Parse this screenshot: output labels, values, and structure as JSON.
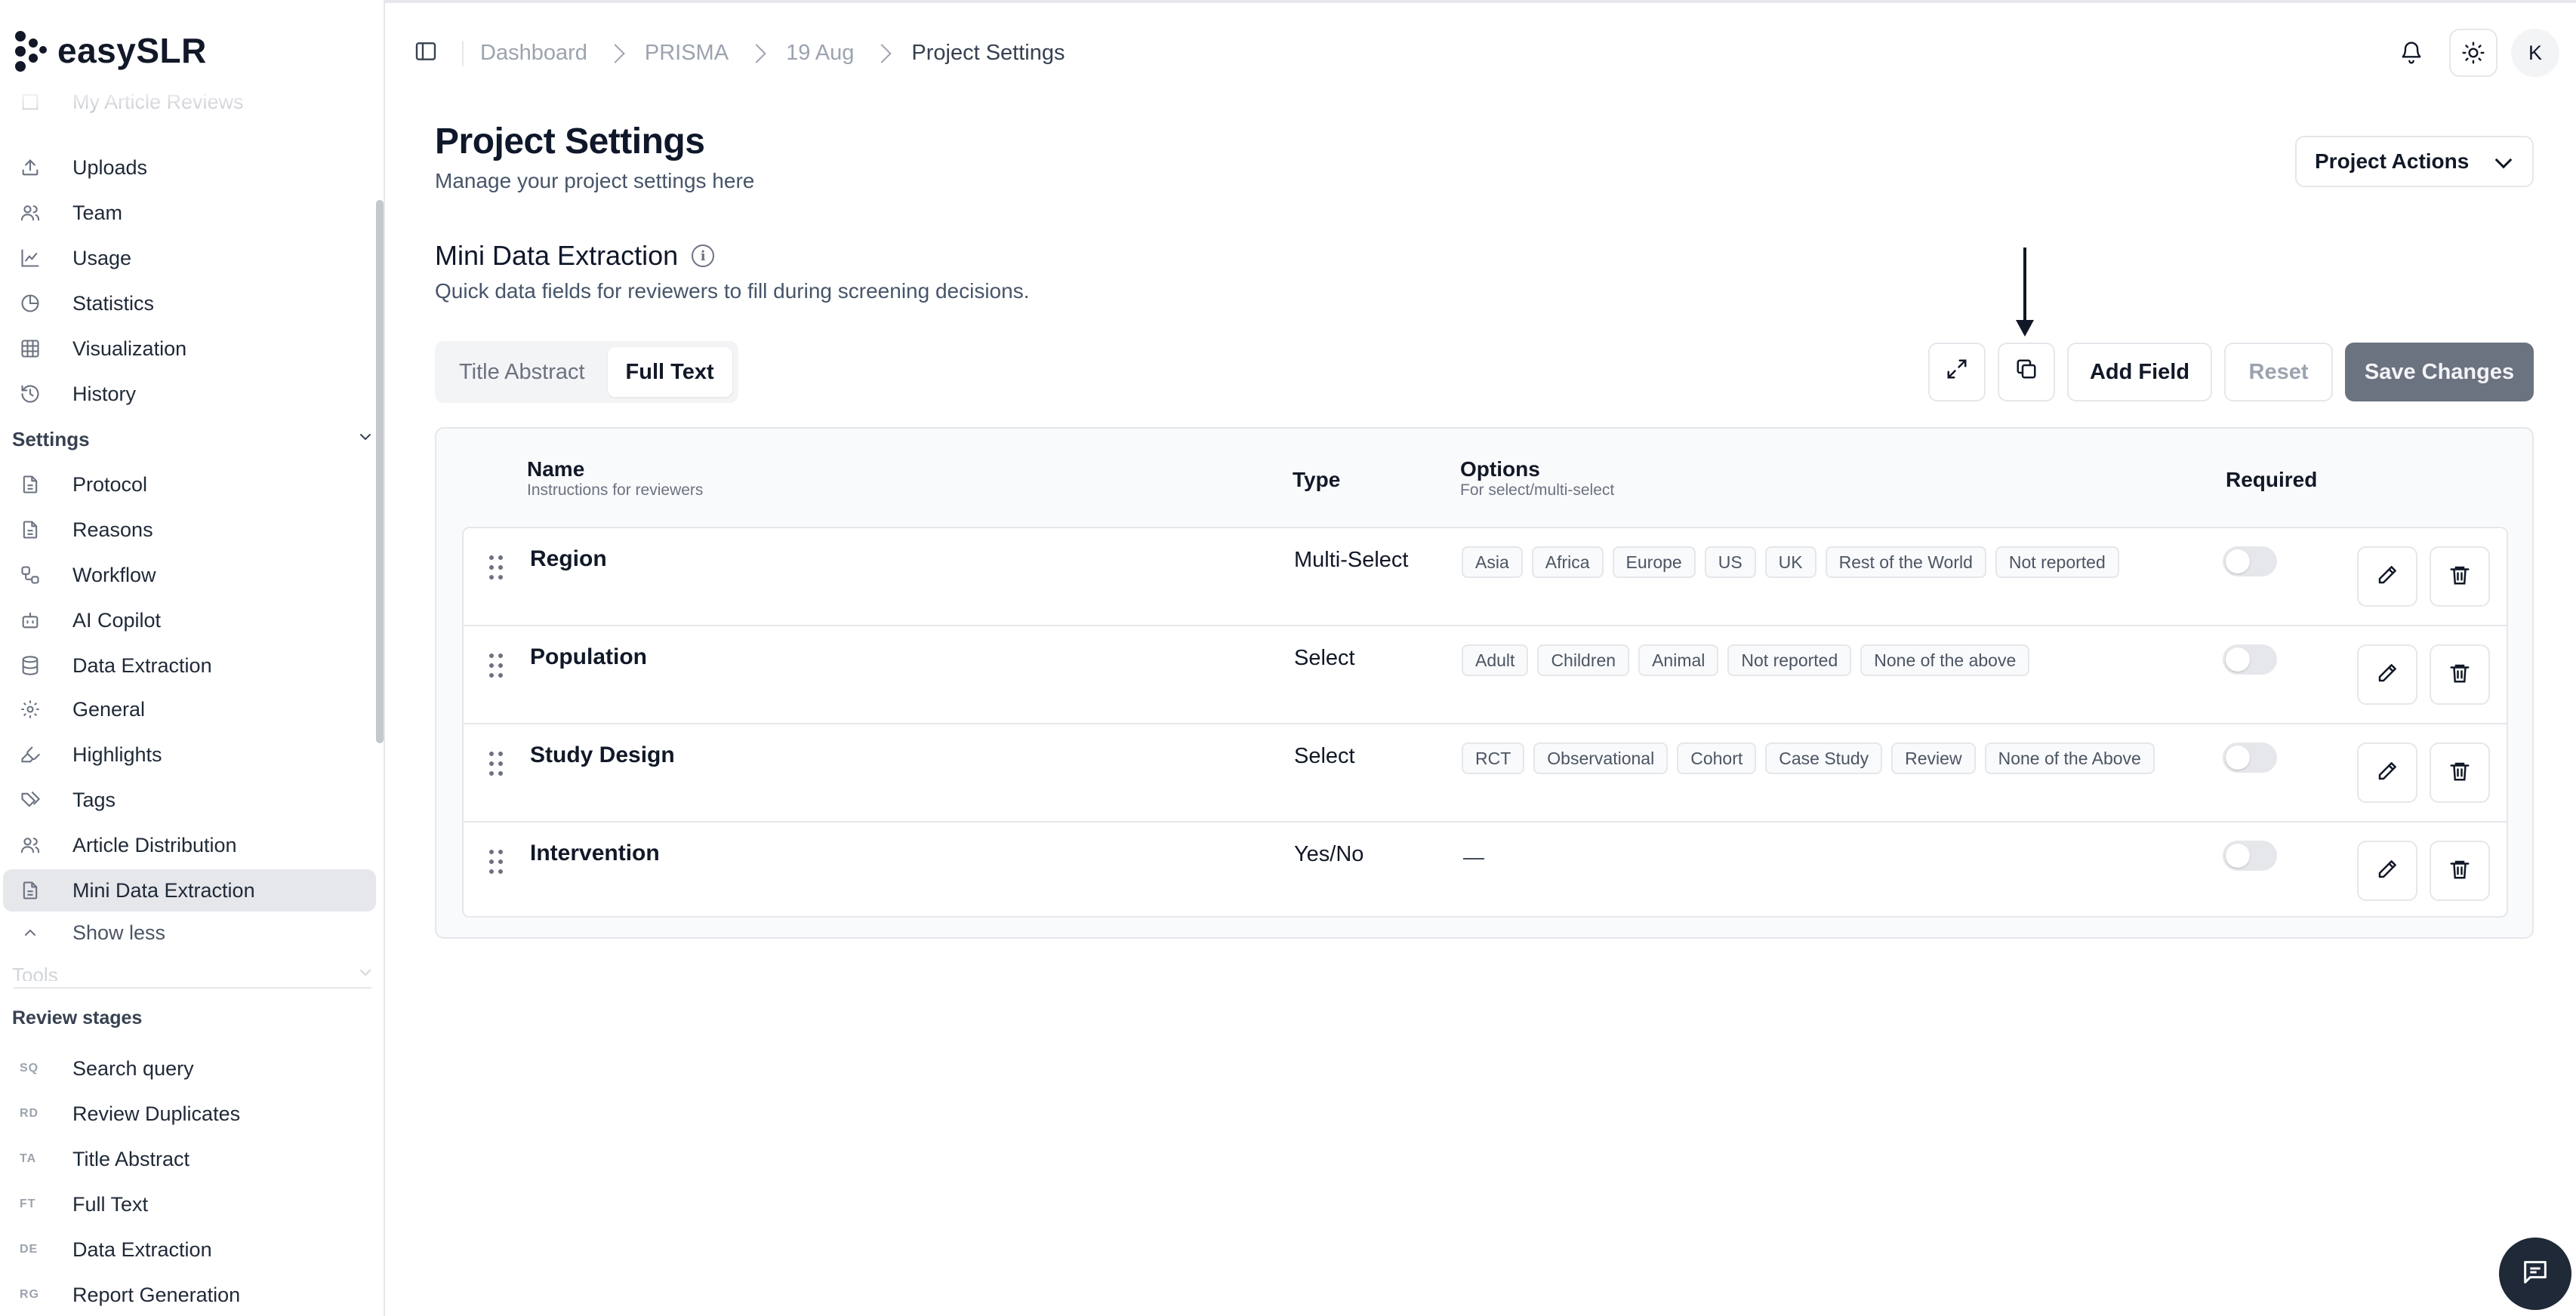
{
  "app": {
    "name": "easySLR"
  },
  "sidebar": {
    "partial_item": "My Article Reviews",
    "items": [
      {
        "label": "Uploads",
        "icon": "upload-icon"
      },
      {
        "label": "Team",
        "icon": "users-icon"
      },
      {
        "label": "Usage",
        "icon": "chart-line-icon"
      },
      {
        "label": "Statistics",
        "icon": "pie-chart-icon"
      },
      {
        "label": "Visualization",
        "icon": "grid-icon"
      },
      {
        "label": "History",
        "icon": "history-icon"
      }
    ],
    "settings_section": "Settings",
    "settings_items": [
      {
        "label": "Protocol",
        "icon": "file-icon"
      },
      {
        "label": "Reasons",
        "icon": "file-icon"
      },
      {
        "label": "Workflow",
        "icon": "workflow-icon"
      },
      {
        "label": "AI Copilot",
        "icon": "bot-icon"
      },
      {
        "label": "Data Extraction",
        "icon": "database-icon"
      },
      {
        "label": "General",
        "icon": "gear-icon"
      },
      {
        "label": "Highlights",
        "icon": "highlighter-icon"
      },
      {
        "label": "Tags",
        "icon": "tags-icon"
      },
      {
        "label": "Article Distribution",
        "icon": "users-icon"
      },
      {
        "label": "Mini Data Extraction",
        "icon": "file-icon",
        "active": true
      }
    ],
    "show_less": "Show less",
    "tools_section": "Tools",
    "review_stages_title": "Review stages",
    "stages": [
      {
        "abbr": "SQ",
        "label": "Search query"
      },
      {
        "abbr": "RD",
        "label": "Review Duplicates"
      },
      {
        "abbr": "TA",
        "label": "Title Abstract"
      },
      {
        "abbr": "FT",
        "label": "Full Text"
      },
      {
        "abbr": "DE",
        "label": "Data Extraction"
      },
      {
        "abbr": "RG",
        "label": "Report Generation"
      }
    ]
  },
  "breadcrumb": [
    "Dashboard",
    "PRISMA",
    "19 Aug",
    "Project Settings"
  ],
  "user": {
    "initial": "K"
  },
  "page": {
    "title": "Project Settings",
    "subtitle": "Manage your project settings here",
    "actions_label": "Project Actions"
  },
  "section": {
    "title": "Mini Data Extraction",
    "subtitle": "Quick data fields for reviewers to fill during screening decisions."
  },
  "tabs": [
    {
      "label": "Title Abstract",
      "selected": false
    },
    {
      "label": "Full Text",
      "selected": true
    }
  ],
  "toolbar": {
    "add_field": "Add Field",
    "reset": "Reset",
    "save": "Save Changes"
  },
  "table": {
    "headers": {
      "name": "Name",
      "name_sub": "Instructions for reviewers",
      "type": "Type",
      "options": "Options",
      "options_sub": "For select/multi-select",
      "required": "Required"
    },
    "rows": [
      {
        "name": "Region",
        "type": "Multi-Select",
        "options": [
          "Asia",
          "Africa",
          "Europe",
          "US",
          "UK",
          "Rest of the World",
          "Not reported"
        ],
        "required": false
      },
      {
        "name": "Population",
        "type": "Select",
        "options": [
          "Adult",
          "Children",
          "Animal",
          "Not reported",
          "None of the above"
        ],
        "required": false
      },
      {
        "name": "Study Design",
        "type": "Select",
        "options": [
          "RCT",
          "Observational",
          "Cohort",
          "Case Study",
          "Review",
          "None of the Above"
        ],
        "required": false
      },
      {
        "name": "Intervention",
        "type": "Yes/No",
        "options": [],
        "empty_options": "—",
        "required": false
      }
    ]
  },
  "colors": {
    "primary_disabled": "#6b7280",
    "active_nav": "#e5e7eb",
    "border": "#e5e7eb"
  }
}
